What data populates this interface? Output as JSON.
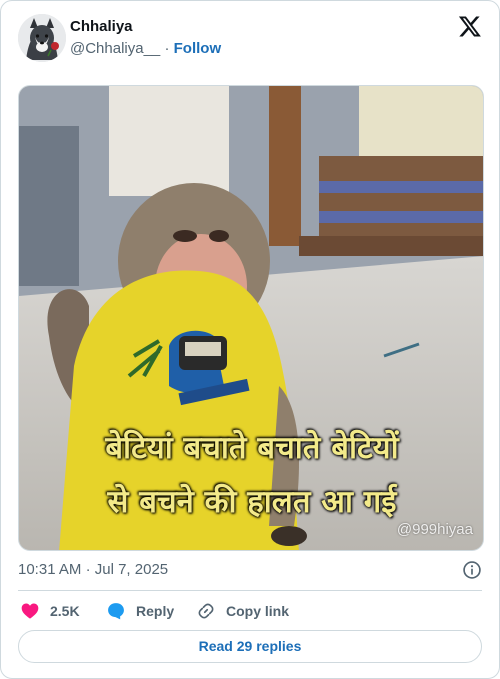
{
  "author": {
    "name": "Chhaliya",
    "handle": "@Chhaliya__",
    "separator": "·",
    "follow_label": "Follow"
  },
  "media": {
    "caption_line1": "बेटियां बचाते बचाते बेटियों",
    "caption_line2": "से बचने की हालत आ गई",
    "watermark": "@999hiyaa"
  },
  "meta": {
    "time": "10:31 AM",
    "separator": "·",
    "date": "Jul 7, 2025"
  },
  "actions": {
    "like_count": "2.5K",
    "reply_label": "Reply",
    "copy_label": "Copy link"
  },
  "read_replies_label": "Read 29 replies",
  "colors": {
    "link_blue": "#1d6fb8",
    "like_pink": "#f91880",
    "reply_blue": "#1d9bf0",
    "text_secondary": "#536471",
    "border": "#cfd9de"
  },
  "icons": {
    "logo": "x-logo-icon",
    "info": "info-icon",
    "like": "heart-icon",
    "reply": "speech-bubble-icon",
    "copy": "link-icon"
  }
}
